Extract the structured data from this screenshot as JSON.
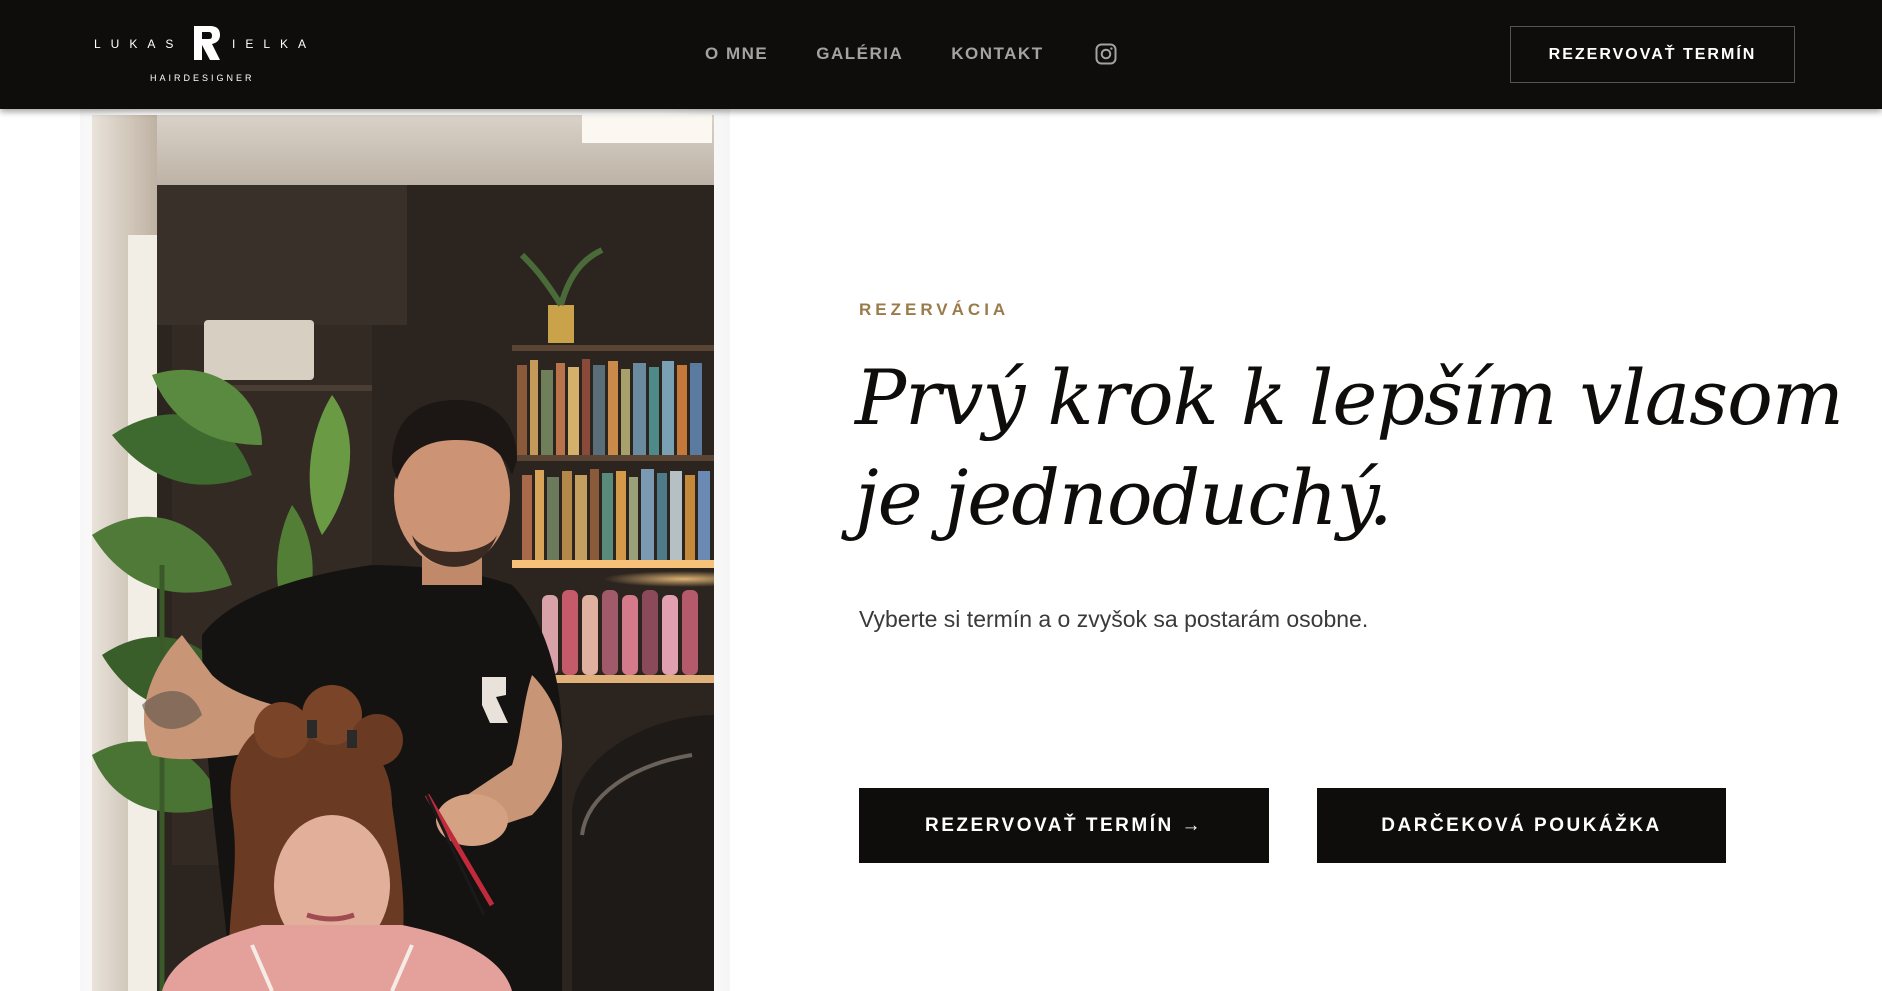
{
  "brand": {
    "first_name": "LUKAS",
    "last_name": "IELKA",
    "tagline": "HAIRDESIGNER",
    "logo_icon": "logo-mark-icon"
  },
  "nav": {
    "items": [
      {
        "label": "O MNE"
      },
      {
        "label": "GALÉRIA"
      },
      {
        "label": "KONTAKT"
      }
    ],
    "instagram_icon": "instagram-icon",
    "cta_label": "REZERVOVAŤ TERMÍN"
  },
  "hero": {
    "eyebrow": "REZERVÁCIA",
    "headline_line1": "Prvý krok k lepším vlasom",
    "headline_line2": "je jednoduchý.",
    "subtext": "Vyberte si termín a o zvyšok sa postarám osobne.",
    "primary_button": "REZERVOVAŤ TERMÍN →",
    "secondary_button": "DARČEKOVÁ POUKÁŽKA"
  },
  "colors": {
    "header_bg": "#0e0d0c",
    "accent_gold": "#9a7b4a",
    "nav_text": "#a3a3a3",
    "button_bg": "#0e0d0c",
    "body_text": "#3a3a3a"
  }
}
